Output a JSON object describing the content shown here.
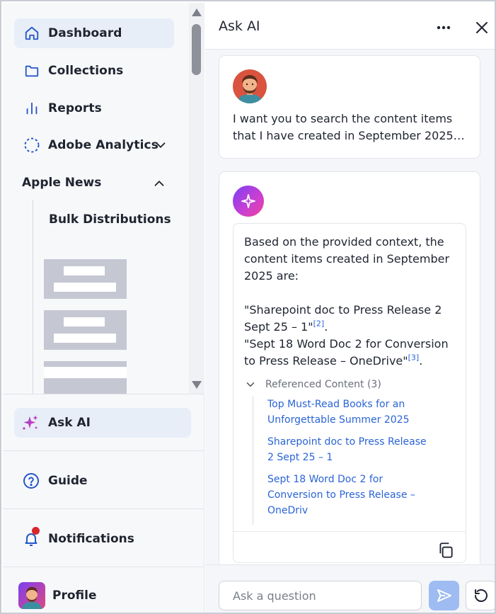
{
  "sidebar": {
    "items": [
      {
        "label": "Dashboard",
        "icon": "home-icon",
        "active": true
      },
      {
        "label": "Collections",
        "icon": "folder-icon"
      },
      {
        "label": "Reports",
        "icon": "bar-chart-icon"
      },
      {
        "label": "Adobe Analytics",
        "icon": "analytics-dashed-circle-icon",
        "chevron": "chevron-down-icon"
      }
    ],
    "section": {
      "label": "Apple News",
      "chevron": "chevron-up-icon",
      "sub_items": [
        {
          "label": "Bulk Distributions"
        }
      ]
    },
    "ask_ai": {
      "label": "Ask AI",
      "icon": "sparkle-icon",
      "active": true
    },
    "guide": {
      "label": "Guide",
      "icon": "question-circle-icon"
    },
    "notifications": {
      "label": "Notifications",
      "icon": "bell-icon",
      "has_unread": true
    },
    "profile": {
      "label": "Profile",
      "icon": "avatar"
    }
  },
  "panel": {
    "title": "Ask AI",
    "more_icon": "more-horizontal-icon",
    "close_icon": "close-icon",
    "user_message": {
      "lines": [
        "I want you to search the content items",
        "that I have created in September 2025…"
      ]
    },
    "ai_response": {
      "intro_lines": [
        "Based on the provided context, the",
        "content items created in September",
        "2025 are:"
      ],
      "item1_line1": "\"Sharepoint doc to Press Release 2",
      "item1_line2": "Sept 25 – 1\"",
      "item1_cite": "[2]",
      "item2_line1": "\"Sept 18 Word Doc 2 for Conversion",
      "item2_line2": "to Press Release – OneDrive\"",
      "item2_cite": "[3]",
      "period": ".",
      "referenced_label": "Referenced Content (3)",
      "references": [
        {
          "lines": [
            "Top Must-Read Books for an",
            "Unforgettable Summer 2025"
          ]
        },
        {
          "lines": [
            "Sharepoint doc to Press Release",
            "2 Sept 25 – 1"
          ]
        },
        {
          "lines": [
            "Sept 18 Word Doc 2 for",
            "Conversion to Press Release –",
            "OneDriv"
          ]
        }
      ],
      "copy_icon": "copy-icon"
    },
    "input": {
      "placeholder": "Ask a question",
      "value": ""
    },
    "send_icon": "send-icon",
    "reset_icon": "refresh-icon"
  },
  "colors": {
    "accent_blue": "#2a64d6",
    "active_bg": "#e8eef8",
    "send_bg": "#9ebcf2",
    "notification_dot": "#d9252b",
    "ai_gradient_start": "#7b3ff2",
    "ai_gradient_end": "#f0439a"
  }
}
